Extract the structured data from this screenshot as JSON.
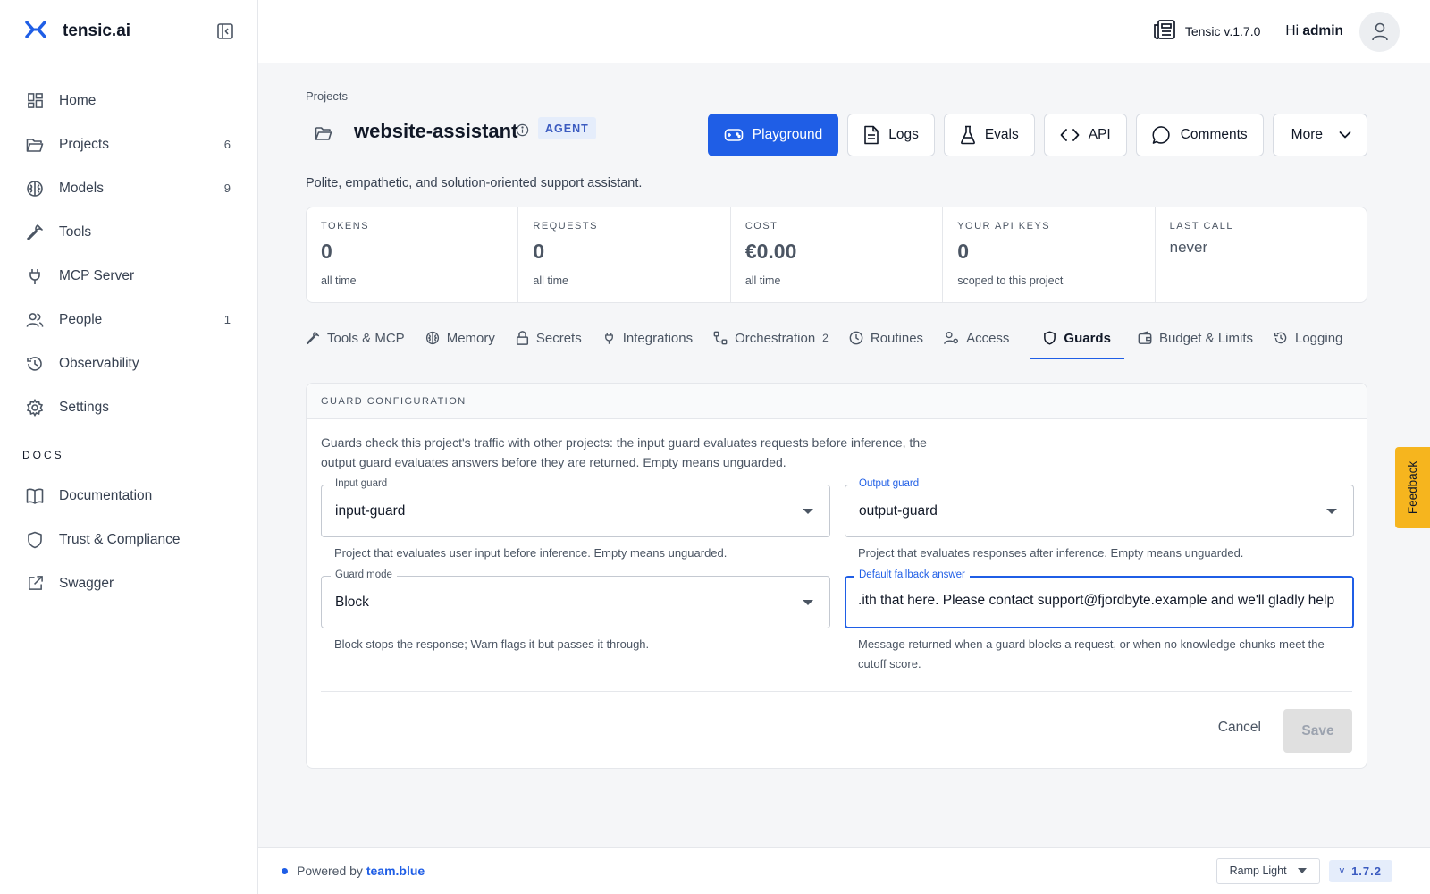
{
  "brand": {
    "name": "tensic.ai"
  },
  "sidebar": {
    "items": [
      {
        "label": "Home",
        "count": ""
      },
      {
        "label": "Projects",
        "count": "6"
      },
      {
        "label": "Models",
        "count": "9"
      },
      {
        "label": "Tools",
        "count": ""
      },
      {
        "label": "MCP Server",
        "count": ""
      },
      {
        "label": "People",
        "count": "1"
      },
      {
        "label": "Observability",
        "count": ""
      },
      {
        "label": "Settings",
        "count": ""
      }
    ],
    "docs_heading": "DOCS",
    "docs": [
      {
        "label": "Documentation"
      },
      {
        "label": "Trust & Compliance"
      },
      {
        "label": "Swagger"
      }
    ]
  },
  "topbar": {
    "version": "Tensic v.1.7.0",
    "greeting": "Hi",
    "user": "admin"
  },
  "project": {
    "breadcrumb": "Projects",
    "title": "website-assistant",
    "badge": "AGENT",
    "description": "Polite, empathetic, and solution-oriented support assistant.",
    "actions": {
      "playground": "Playground",
      "logs": "Logs",
      "evals": "Evals",
      "api": "API",
      "comments": "Comments",
      "more": "More"
    }
  },
  "stats": [
    {
      "label": "TOKENS",
      "value": "0",
      "sub": "all time"
    },
    {
      "label": "REQUESTS",
      "value": "0",
      "sub": "all time"
    },
    {
      "label": "COST",
      "value": "€0.00",
      "sub": "all time"
    },
    {
      "label": "YOUR API KEYS",
      "value": "0",
      "sub": "scoped to this project"
    },
    {
      "label": "LAST CALL",
      "value": "never",
      "sub": ""
    }
  ],
  "tabs": [
    {
      "label": "Tools & MCP",
      "count": ""
    },
    {
      "label": "Memory",
      "count": ""
    },
    {
      "label": "Secrets",
      "count": ""
    },
    {
      "label": "Integrations",
      "count": ""
    },
    {
      "label": "Orchestration",
      "count": "2"
    },
    {
      "label": "Routines",
      "count": ""
    },
    {
      "label": "Access",
      "count": ""
    },
    {
      "label": "Guards",
      "count": ""
    },
    {
      "label": "Budget & Limits",
      "count": ""
    },
    {
      "label": "Logging",
      "count": ""
    }
  ],
  "guard_config": {
    "heading": "GUARD CONFIGURATION",
    "intro": "Guards check this project's traffic with other projects: the input guard evaluates requests before inference, the output guard evaluates answers before they are returned. Empty means unguarded.",
    "input_guard": {
      "label": "Input guard",
      "value": "input-guard",
      "help": "Project that evaluates user input before inference. Empty means unguarded."
    },
    "output_guard": {
      "label": "Output guard",
      "value": "output-guard",
      "help": "Project that evaluates responses after inference. Empty means unguarded."
    },
    "guard_mode": {
      "label": "Guard mode",
      "value": "Block",
      "help": "Block stops the response; Warn flags it but passes it through."
    },
    "fallback": {
      "label": "Default fallback answer",
      "value": "ith that here. Please contact support@fjordbyte.example and we'll gladly help.",
      "help": "Message returned when a guard blocks a request, or when no knowledge chunks meet the cutoff score."
    },
    "cancel": "Cancel",
    "save": "Save"
  },
  "footer": {
    "powered_prefix": "Powered by",
    "powered_brand": "team.blue",
    "theme": "Ramp Light",
    "version_prefix": "v",
    "version": "1.7.2"
  },
  "feedback": "Feedback",
  "colors": {
    "accent": "#1f5ee6",
    "feedback": "#f6b51e",
    "badge_bg": "#e5edfb"
  }
}
